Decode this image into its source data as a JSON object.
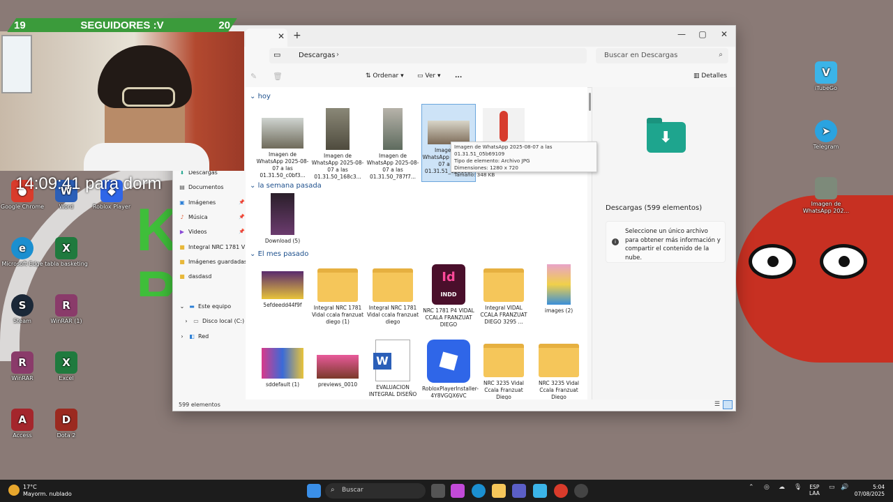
{
  "overlay": {
    "followers_left": "19",
    "followers_label": "SEGUIDORES :V",
    "followers_right": "20",
    "clock_text": "14:09:41 para dorm"
  },
  "desktop": {
    "icons": [
      {
        "label": "Google Chrome"
      },
      {
        "label": "Word"
      },
      {
        "label": "Roblox Player"
      },
      {
        "label": "Microsoft Edge"
      },
      {
        "label": "tabla basketing"
      },
      {
        "label": "Steam"
      },
      {
        "label": "WinRAR (1)"
      },
      {
        "label": "WinRAR"
      },
      {
        "label": "Excel"
      },
      {
        "label": "Access"
      },
      {
        "label": "Dota 2"
      },
      {
        "label": "iTubeGo"
      },
      {
        "label": "Telegram"
      },
      {
        "label": "Imagen de WhatsApp 202..."
      }
    ]
  },
  "explorer": {
    "address": {
      "location": "Descargas",
      "search_placeholder": "Buscar en Descargas"
    },
    "toolbar": {
      "sort": "Ordenar",
      "view": "Ver",
      "more": "...",
      "details": "Detalles"
    },
    "sidebar": {
      "items": [
        {
          "label": "Descargas"
        },
        {
          "label": "Documentos"
        },
        {
          "label": "Imágenes"
        },
        {
          "label": "Música"
        },
        {
          "label": "Videos"
        },
        {
          "label": "Integral NRC 1781 V"
        },
        {
          "label": "Imágenes guardadas"
        },
        {
          "label": "dasdasd"
        },
        {
          "label": "Este equipo"
        },
        {
          "label": "Disco local (C:)"
        },
        {
          "label": "Red"
        }
      ]
    },
    "sections": {
      "today": "hoy",
      "last_week": "la semana pasada",
      "last_month": "El mes pasado"
    },
    "files_today": [
      "Imagen de WhatsApp 2025-08-07 a las 01.31.50_c0bf3...",
      "Imagen de WhatsApp 2025-08-07 a las 01.31.50_168c3...",
      "Imagen de WhatsApp 2025-08-07 a las 01.31.50_787f7...",
      "Imagen de WhatsApp 2025-08-07 a las 01.31.51_05b69..."
    ],
    "files_week": [
      "Download (5)"
    ],
    "files_month_row1": [
      "5efdeedd44f9f",
      "Integral NRC 1781 Vidal ccala franzuat diego (1)",
      "Integral NRC 1781 Vidal ccala franzuat diego",
      "NRC 1781 P4 VIDAL CCALA FRANZUAT DIEGO",
      "Integral VIDAL CCALA FRANZUAT DIEGO 3295 ...",
      "images (2)"
    ],
    "files_month_row2": [
      "sddefault (1)",
      "previews_0010",
      "EVALUACION INTEGRAL DISEÑO",
      "RobloxPlayerInstaller-4Y8VGQX6VC",
      "NRC 3235 Vidal Ccala Franzuat Diego",
      "NRC 3235 Vidal Ccala Franzuat Diego"
    ],
    "indd_label": "Id",
    "indd_ext": "INDD",
    "tooltip": {
      "name": "Imagen de WhatsApp 2025-08-07 a las 01.31.51_05b69109",
      "type": "Tipo de elemento: Archivo JPG",
      "dims": "Dimensiones: 1280 x 720",
      "size": "Tamaño: 348 KB"
    },
    "details_panel": {
      "title": "Descargas (599 elementos)",
      "info": "Seleccione un único archivo para obtener más información y compartir el contenido de la nube."
    },
    "status": "599 elementos"
  },
  "taskbar": {
    "weather_temp": "17°C",
    "weather_desc": "Mayorm. nublado",
    "search_placeholder": "Buscar",
    "lang_top": "ESP",
    "lang_bottom": "LAA",
    "time": "5:04",
    "date": "07/08/2025"
  }
}
